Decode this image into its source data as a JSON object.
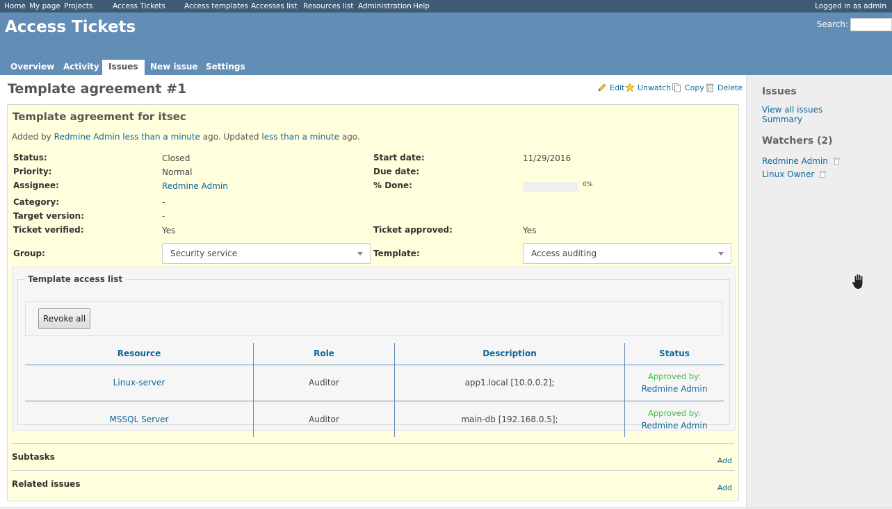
{
  "top_menu": {
    "items": [
      "Home",
      "My page",
      "Projects",
      "Access Tickets",
      "Access templates",
      "Accesses list",
      "Resources list",
      "Administration",
      "Help"
    ],
    "logged_as": "Logged in as admin"
  },
  "header": {
    "title": "Access Tickets",
    "search_label": "Search:"
  },
  "main_menu": {
    "tabs": [
      "Overview",
      "Activity",
      "Issues",
      "New issue",
      "Settings"
    ],
    "selected": "Issues"
  },
  "page": {
    "title": "Template agreement #1",
    "actions": {
      "edit": "Edit",
      "unwatch": "Unwatch",
      "copy": "Copy",
      "delete": "Delete"
    }
  },
  "issue": {
    "subject": "Template agreement for itsec",
    "author_line": {
      "prefix": "Added by",
      "author": "Redmine Admin",
      "added": "less than a minute",
      "middle": "ago. Updated",
      "updated": "less than a minute",
      "suffix": "ago."
    },
    "fields": {
      "status_label": "Status:",
      "status": "Closed",
      "priority_label": "Priority:",
      "priority": "Normal",
      "assignee_label": "Assignee:",
      "assignee": "Redmine Admin",
      "category_label": "Category:",
      "category": "-",
      "target_version_label": "Target version:",
      "target_version": "-",
      "ticket_verified_label": "Ticket verified:",
      "ticket_verified": "Yes",
      "start_date_label": "Start date:",
      "start_date": "11/29/2016",
      "due_date_label": "Due date:",
      "done_label": "% Done:",
      "done": "0%",
      "done_fraction": 0,
      "ticket_approved_label": "Ticket approved:",
      "ticket_approved": "Yes",
      "group_label": "Group:",
      "group": "Security service",
      "template_label": "Template:",
      "template": "Access auditing"
    },
    "access_list": {
      "legend": "Template access list",
      "revoke_button": "Revoke all",
      "columns": [
        "Resource",
        "Role",
        "Description",
        "Status"
      ],
      "rows": [
        {
          "resource": "Linux-server",
          "role": "Auditor",
          "description": "app1.local [10.0.0.2];",
          "status": "Approved by:",
          "approver": "Redmine Admin"
        },
        {
          "resource": "MSSQL Server",
          "role": "Auditor",
          "description": "main-db [192.168.0.5];",
          "status": "Approved by:",
          "approver": "Redmine Admin"
        }
      ]
    },
    "subtasks": {
      "title": "Subtasks",
      "add": "Add"
    },
    "related": {
      "title": "Related issues",
      "add": "Add"
    }
  },
  "sidebar": {
    "issues_title": "Issues",
    "view_all": "View all issues",
    "summary": "Summary",
    "watchers_title": "Watchers (2)",
    "watchers": [
      "Redmine Admin",
      "Linux Owner"
    ]
  },
  "colors": {
    "top_menu": "#3E5B76",
    "header": "#628DB6",
    "issue_bg": "#FFFFDD",
    "link": "#116699",
    "approved": "#4AB64A"
  }
}
